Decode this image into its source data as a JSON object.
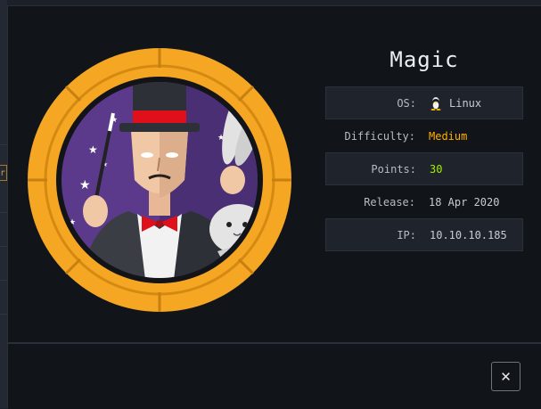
{
  "machine": {
    "name": "Magic",
    "info": [
      {
        "label": "OS:",
        "value": "Linux",
        "icon": "linux-tux-icon"
      },
      {
        "label": "Difficulty:",
        "value": "Medium",
        "color": "#ffaf00"
      },
      {
        "label": "Points:",
        "value": "30",
        "color": "#9fef00"
      },
      {
        "label": "Release:",
        "value": "18 Apr 2020"
      },
      {
        "label": "IP:",
        "value": "10.10.10.185"
      }
    ]
  },
  "background": {
    "tab_fragment": "r"
  },
  "footer": {
    "close_symbol": "✕"
  },
  "colors": {
    "ring": "#f5a623",
    "medium": "#ffaf00",
    "points": "#9fef00",
    "hat_band": "#e0101a"
  }
}
